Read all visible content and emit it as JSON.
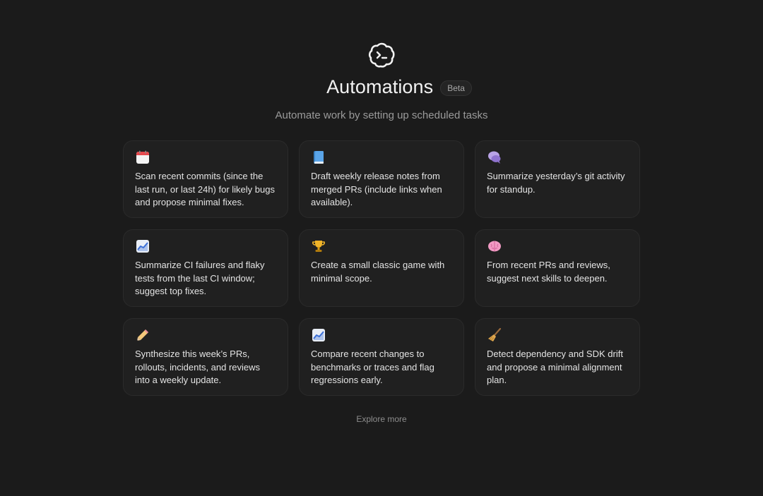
{
  "header": {
    "title": "Automations",
    "badge": "Beta",
    "subtitle": "Automate work by setting up scheduled tasks"
  },
  "cards": [
    {
      "icon": "calendar-icon",
      "text": "Scan recent commits (since the last run, or last 24h) for likely bugs and propose minimal fixes."
    },
    {
      "icon": "book-icon",
      "text": "Draft weekly release notes from merged PRs (include links when available)."
    },
    {
      "icon": "speech-bubble-icon",
      "text": "Summarize yesterday’s git activity for standup."
    },
    {
      "icon": "chart-increasing-icon",
      "text": "Summarize CI failures and flaky tests from the last CI window; suggest top fixes."
    },
    {
      "icon": "trophy-icon",
      "text": "Create a small classic game with minimal scope."
    },
    {
      "icon": "brain-icon",
      "text": "From recent PRs and reviews, suggest next skills to deepen."
    },
    {
      "icon": "pencil-icon",
      "text": "Synthesize this week’s PRs, rollouts, incidents, and reviews into a weekly update."
    },
    {
      "icon": "chart-increasing-icon",
      "text": "Compare recent changes to benchmarks or traces and flag regressions early."
    },
    {
      "icon": "broom-icon",
      "text": "Detect dependency and SDK drift and propose a minimal alignment plan."
    }
  ],
  "footer": {
    "explore_label": "Explore more"
  }
}
